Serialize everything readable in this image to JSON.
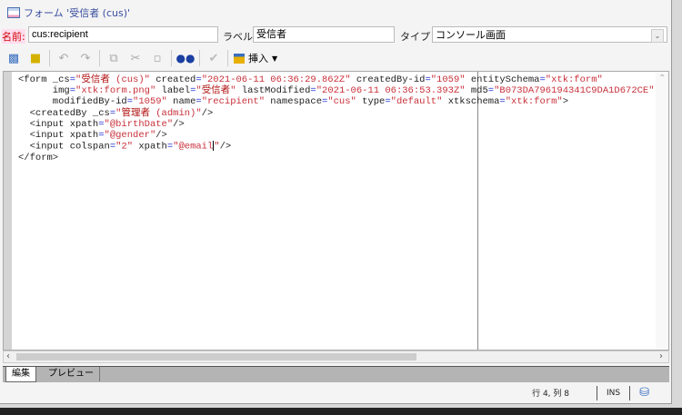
{
  "window": {
    "title": "フォーム '受信者 (cus)'"
  },
  "fields": {
    "name_label": "名前:",
    "name_value": "cus:recipient",
    "label_label": "ラベル:",
    "label_value": "受信者",
    "type_label": "タイプ :",
    "type_value": "コンソール画面"
  },
  "toolbar": {
    "insert_label": "挿入"
  },
  "code": [
    [
      [
        "a",
        "<form _cs"
      ],
      [
        "e",
        "="
      ],
      [
        "v",
        "\""
      ],
      [
        "j",
        "受信者"
      ],
      [
        "v",
        " (cus)\""
      ],
      [
        "a",
        " created"
      ],
      [
        "e",
        "="
      ],
      [
        "v",
        "\"2021-06-11 06:36:29.862Z\""
      ],
      [
        "a",
        " createdBy-id"
      ],
      [
        "e",
        "="
      ],
      [
        "v",
        "\"1059\""
      ],
      [
        "a",
        " entitySchema"
      ],
      [
        "e",
        "="
      ],
      [
        "v",
        "\"xtk:form\""
      ]
    ],
    [
      [
        "a",
        "      img"
      ],
      [
        "e",
        "="
      ],
      [
        "v",
        "\"xtk:form.png\""
      ],
      [
        "a",
        " label"
      ],
      [
        "e",
        "="
      ],
      [
        "v",
        "\""
      ],
      [
        "j",
        "受信者"
      ],
      [
        "v",
        "\""
      ],
      [
        "a",
        " lastModified"
      ],
      [
        "e",
        "="
      ],
      [
        "v",
        "\"2021-06-11 06:36:53.393Z\""
      ],
      [
        "a",
        " md5"
      ],
      [
        "e",
        "="
      ],
      [
        "v",
        "\"B073DA796194341C9DA1D672CE\""
      ]
    ],
    [
      [
        "a",
        "      modifiedBy-id"
      ],
      [
        "e",
        "="
      ],
      [
        "v",
        "\"1059\""
      ],
      [
        "a",
        " name"
      ],
      [
        "e",
        "="
      ],
      [
        "v",
        "\"recipient\""
      ],
      [
        "a",
        " namespace"
      ],
      [
        "e",
        "="
      ],
      [
        "v",
        "\"cus\""
      ],
      [
        "a",
        " type"
      ],
      [
        "e",
        "="
      ],
      [
        "v",
        "\"default\""
      ],
      [
        "a",
        " xtkschema"
      ],
      [
        "e",
        "="
      ],
      [
        "v",
        "\"xtk:form\""
      ],
      [
        "a",
        ">"
      ]
    ],
    [
      [
        "a",
        "  <createdBy _cs"
      ],
      [
        "e",
        "="
      ],
      [
        "v",
        "\""
      ],
      [
        "j",
        "管理者"
      ],
      [
        "v",
        " (admin)\""
      ],
      [
        "a",
        "/>"
      ]
    ],
    [
      [
        "a",
        "  <input xpath"
      ],
      [
        "e",
        "="
      ],
      [
        "v",
        "\"@birthDate\""
      ],
      [
        "a",
        "/>"
      ]
    ],
    [
      [
        "a",
        "  <input xpath"
      ],
      [
        "e",
        "="
      ],
      [
        "v",
        "\"@gender\""
      ],
      [
        "a",
        "/>"
      ]
    ],
    [
      [
        "a",
        "  <input colspan"
      ],
      [
        "e",
        "="
      ],
      [
        "v",
        "\"2\""
      ],
      [
        "a",
        " xpath"
      ],
      [
        "e",
        "="
      ],
      [
        "v",
        "\"@email"
      ],
      [
        "cursor",
        ""
      ],
      [
        "v",
        "\""
      ],
      [
        "a",
        "/>"
      ]
    ],
    [
      [
        "a",
        "</form>"
      ]
    ]
  ],
  "tabs": [
    {
      "label": "編集",
      "active": true
    },
    {
      "label": "プレビュー",
      "active": false
    }
  ],
  "status": {
    "position": "行 4, 列 8",
    "mode": "INS"
  }
}
